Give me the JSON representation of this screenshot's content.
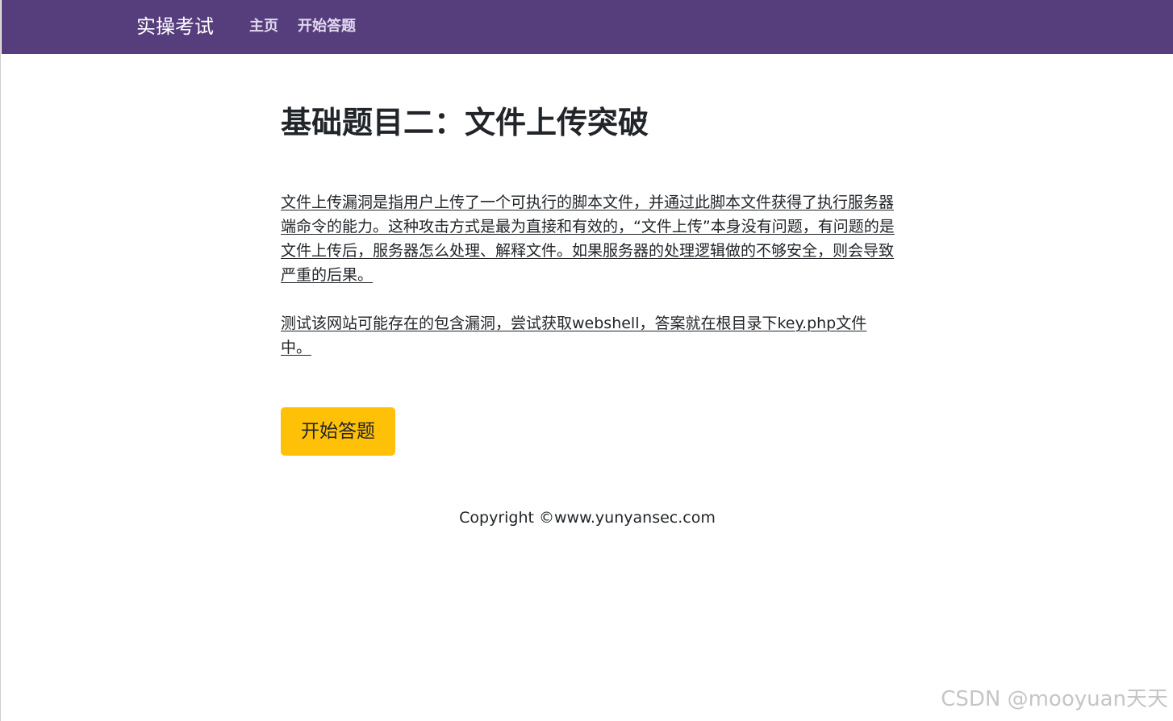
{
  "navbar": {
    "brand": "实操考试",
    "links": [
      {
        "label": "主页"
      },
      {
        "label": "开始答题"
      }
    ],
    "color": "#563d7c"
  },
  "main": {
    "title": "基础题目二：文件上传突破",
    "description": "文件上传漏洞是指用户上传了一个可执行的脚本文件，并通过此脚本文件获得了执行服务器端命令的能力。这种攻击方式是最为直接和有效的，“文件上传”本身没有问题，有问题的是文件上传后，服务器怎么处理、解释文件。如果服务器的处理逻辑做的不够安全，则会导致严重的后果。",
    "task": "测试该网站可能存在的包含漏洞，尝试获取webshell，答案就在根目录下key.php文件中。",
    "start_button": "开始答题",
    "button_color": "#ffc107"
  },
  "footer": {
    "copyright": "Copyright ©www.yunyansec.com"
  },
  "watermark": "CSDN @mooyuan天天"
}
